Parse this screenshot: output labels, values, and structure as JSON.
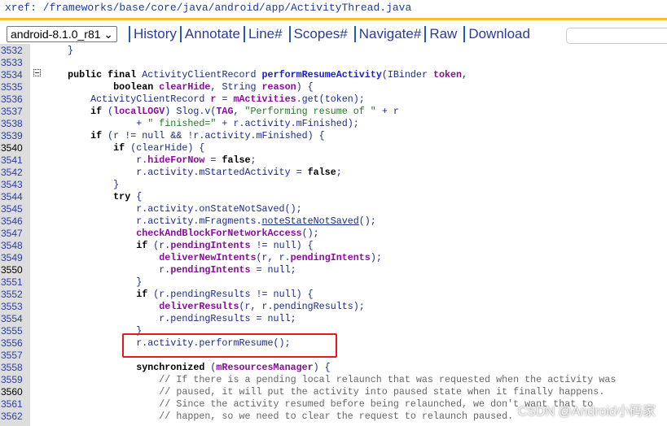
{
  "xref": "xref: /frameworks/base/core/java/android/app/ActivityThread.java",
  "accent": "#f5c12e",
  "version_select": "android-8.1.0_r81",
  "nav": [
    "History",
    "Annotate",
    "Line#",
    "Scopes#",
    "Navigate#",
    "Raw",
    "Download"
  ],
  "highlight_color": "#e8191c",
  "watermark": "CSDN @Android小码家",
  "lines": [
    {
      "n": "3532",
      "t": [
        [
          "n",
          "    }"
        ]
      ]
    },
    {
      "n": "3533",
      "t": []
    },
    {
      "n": "3534",
      "t": [
        [
          "n",
          "    "
        ],
        [
          "kw",
          "public final"
        ],
        [
          "n",
          " ActivityClientRecord "
        ],
        [
          "bm",
          "performResumeActivity"
        ],
        [
          "n",
          "(IBinder "
        ],
        [
          "bf",
          "token"
        ],
        [
          "n",
          ","
        ]
      ]
    },
    {
      "n": "3535",
      "t": [
        [
          "n",
          "            "
        ],
        [
          "kw",
          "boolean"
        ],
        [
          "n",
          " "
        ],
        [
          "bf",
          "clearHide"
        ],
        [
          "n",
          ", String "
        ],
        [
          "bf",
          "reason"
        ],
        [
          "n",
          ") {"
        ]
      ]
    },
    {
      "n": "3536",
      "t": [
        [
          "n",
          "        ActivityClientRecord "
        ],
        [
          "bf",
          "r"
        ],
        [
          "n",
          " = "
        ],
        [
          "bf",
          "mActivities"
        ],
        [
          "n",
          ".get(token);"
        ]
      ]
    },
    {
      "n": "3537",
      "t": [
        [
          "n",
          "        "
        ],
        [
          "kw",
          "if"
        ],
        [
          "n",
          " ("
        ],
        [
          "bf",
          "localLOGV"
        ],
        [
          "n",
          ") Slog.v("
        ],
        [
          "bf",
          "TAG"
        ],
        [
          "n",
          ", "
        ],
        [
          "s",
          "\"Performing resume of \""
        ],
        [
          "n",
          " + r"
        ]
      ]
    },
    {
      "n": "3538",
      "t": [
        [
          "n",
          "                + "
        ],
        [
          "s",
          "\" finished=\""
        ],
        [
          "n",
          " + r.activity.mFinished);"
        ]
      ]
    },
    {
      "n": "3539",
      "t": [
        [
          "n",
          "        "
        ],
        [
          "kw",
          "if"
        ],
        [
          "n",
          " (r != null && !r.activity.mFinished) {"
        ]
      ]
    },
    {
      "n": "3540",
      "b": true,
      "t": [
        [
          "n",
          "            "
        ],
        [
          "kw",
          "if"
        ],
        [
          "n",
          " (clearHide) {"
        ]
      ]
    },
    {
      "n": "3541",
      "t": [
        [
          "n",
          "                r."
        ],
        [
          "bf",
          "hideForNow"
        ],
        [
          "n",
          " = "
        ],
        [
          "kw",
          "false"
        ],
        [
          "n",
          ";"
        ]
      ]
    },
    {
      "n": "3542",
      "t": [
        [
          "n",
          "                r.activity.mStartedActivity = "
        ],
        [
          "kw",
          "false"
        ],
        [
          "n",
          ";"
        ]
      ]
    },
    {
      "n": "3543",
      "t": [
        [
          "n",
          "            }"
        ]
      ]
    },
    {
      "n": "3544",
      "t": [
        [
          "n",
          "            "
        ],
        [
          "kw",
          "try"
        ],
        [
          "n",
          " {"
        ]
      ]
    },
    {
      "n": "3545",
      "t": [
        [
          "n",
          "                r.activity.onStateNotSaved();"
        ]
      ]
    },
    {
      "n": "3546",
      "t": [
        [
          "n",
          "                r.activity.mFragments."
        ],
        [
          "u",
          "noteStateNotSaved"
        ],
        [
          "n",
          "();"
        ]
      ]
    },
    {
      "n": "3547",
      "t": [
        [
          "n",
          "                "
        ],
        [
          "bf",
          "checkAndBlockForNetworkAccess"
        ],
        [
          "n",
          "();"
        ]
      ]
    },
    {
      "n": "3548",
      "t": [
        [
          "n",
          "                "
        ],
        [
          "kw",
          "if"
        ],
        [
          "n",
          " (r."
        ],
        [
          "bf",
          "pendingIntents"
        ],
        [
          "n",
          " != null) {"
        ]
      ]
    },
    {
      "n": "3549",
      "t": [
        [
          "n",
          "                    "
        ],
        [
          "bf",
          "deliverNewIntents"
        ],
        [
          "n",
          "(r, r."
        ],
        [
          "bf",
          "pendingIntents"
        ],
        [
          "n",
          ");"
        ]
      ]
    },
    {
      "n": "3550",
      "b": true,
      "t": [
        [
          "n",
          "                    r."
        ],
        [
          "bf",
          "pendingIntents"
        ],
        [
          "n",
          " = null;"
        ]
      ]
    },
    {
      "n": "3551",
      "t": [
        [
          "n",
          "                }"
        ]
      ]
    },
    {
      "n": "3552",
      "t": [
        [
          "n",
          "                "
        ],
        [
          "kw",
          "if"
        ],
        [
          "n",
          " (r.pendingResults != null) {"
        ]
      ]
    },
    {
      "n": "3553",
      "t": [
        [
          "n",
          "                    "
        ],
        [
          "bf",
          "deliverResults"
        ],
        [
          "n",
          "(r, r.pendingResults);"
        ]
      ]
    },
    {
      "n": "3554",
      "t": [
        [
          "n",
          "                    r.pendingResults = null;"
        ]
      ]
    },
    {
      "n": "3555",
      "t": [
        [
          "n",
          "                }"
        ]
      ]
    },
    {
      "n": "3556",
      "t": [
        [
          "n",
          "                r.activity.performResume();"
        ]
      ]
    },
    {
      "n": "3557",
      "t": []
    },
    {
      "n": "3558",
      "t": [
        [
          "n",
          "                "
        ],
        [
          "kw",
          "synchronized"
        ],
        [
          "n",
          " ("
        ],
        [
          "bf",
          "mResourcesManager"
        ],
        [
          "n",
          ") {"
        ]
      ]
    },
    {
      "n": "3559",
      "t": [
        [
          "c",
          "                    // If there is a pending local relaunch that was requested when the activity was"
        ]
      ]
    },
    {
      "n": "3560",
      "b": true,
      "t": [
        [
          "c",
          "                    // paused, it will put the activity into paused state when it finally happens."
        ]
      ]
    },
    {
      "n": "3561",
      "t": [
        [
          "c",
          "                    // Since the activity resumed before being relaunched, we don't want that to"
        ]
      ]
    },
    {
      "n": "3562",
      "t": [
        [
          "c",
          "                    // happen, so we need to clear the request to relaunch paused."
        ]
      ]
    }
  ]
}
